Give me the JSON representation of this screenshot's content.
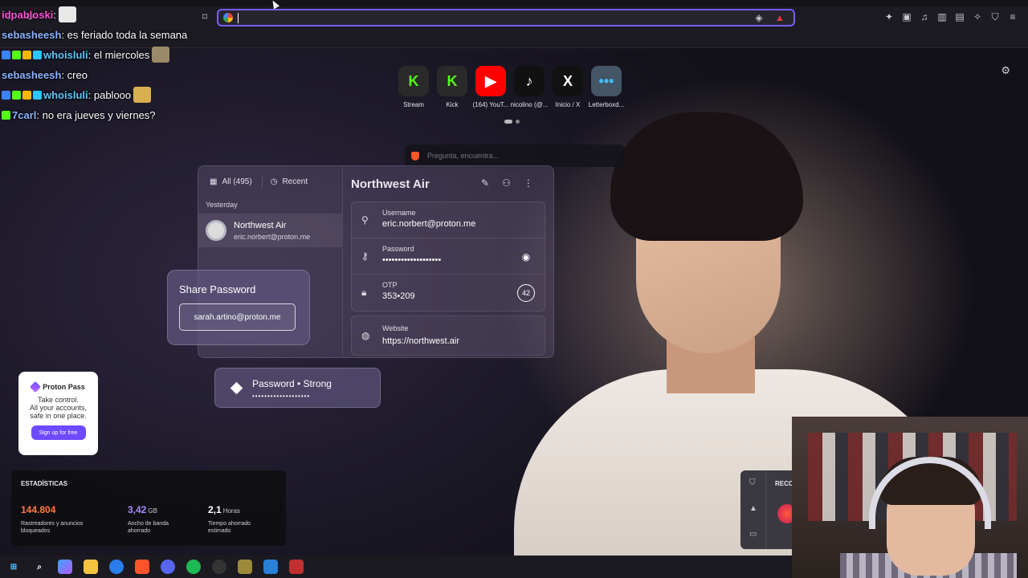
{
  "browser": {
    "url_value": "",
    "url_placeholder": ""
  },
  "chat": [
    {
      "user": "idpabloski",
      "sep": ":",
      "text": "",
      "color": "#ff4fd8"
    },
    {
      "user": "sebasheesh",
      "sep": ":",
      "text": " es feriado toda la semana",
      "color": "#8ab4ff"
    },
    {
      "user": "whoisluli",
      "sep": ":",
      "text": " el miercoles",
      "color": "#5dc8ff"
    },
    {
      "user": "sebasheesh",
      "sep": ":",
      "text": " creo",
      "color": "#8ab4ff"
    },
    {
      "user": "whoisluli",
      "sep": ":",
      "text": " pablooo",
      "color": "#5dc8ff"
    },
    {
      "user": "7carl",
      "sep": ":",
      "text": " no era jueves y viernes?",
      "color": "#8ab4ff"
    }
  ],
  "speed_dial": [
    {
      "label": "Stream",
      "glyph": "K",
      "bg": "#2a2a2a",
      "fg": "#53fc18"
    },
    {
      "label": "Kick",
      "glyph": "K",
      "bg": "#2a2a2a",
      "fg": "#53fc18"
    },
    {
      "label": "(164) YouT...",
      "glyph": "▶",
      "bg": "#ff0000",
      "fg": "#ffffff"
    },
    {
      "label": "nicolino (@...",
      "glyph": "♪",
      "bg": "#111111",
      "fg": "#ffffff"
    },
    {
      "label": "Inicio / X",
      "glyph": "X",
      "bg": "#111111",
      "fg": "#ffffff"
    },
    {
      "label": "Letterboxd...",
      "glyph": "•••",
      "bg": "#445566",
      "fg": "#40bcf4"
    }
  ],
  "search": {
    "placeholder": "Pregunta, encuentra..."
  },
  "pass": {
    "filter_all": "All (495)",
    "filter_recent": "Recent",
    "group": "Yesterday",
    "entry_title": "Northwest Air",
    "entry_email": "eric.norbert@proton.me",
    "item_title": "Northwest Air",
    "username_label": "Username",
    "username_value": "eric.norbert@proton.me",
    "password_label": "Password",
    "password_value": "•••••••••••••••••••",
    "otp_label": "OTP",
    "otp_value": "353•209",
    "otp_timer": "42",
    "website_label": "Website",
    "website_value": "https://northwest.air"
  },
  "share": {
    "title": "Share Password",
    "email": "sarah.artino@proton.me"
  },
  "strong": {
    "title": "Password • Strong",
    "dots": "•••••••••••••••••••"
  },
  "ad": {
    "brand": "Proton Pass",
    "line1": "Take control.",
    "line2": "All your accounts,",
    "line3": "safe in one place.",
    "button": "Sign up for free"
  },
  "stats": {
    "title": "ESTADÍSTICAS",
    "items": [
      {
        "value": "144.804",
        "unit": "",
        "desc1": "Rastreadores y anuncios",
        "desc2": "bloqueados",
        "color": "#ff7a45"
      },
      {
        "value": "3,42",
        "unit": "GB",
        "desc1": "Ancho de banda",
        "desc2": "ahorrado",
        "color": "#a88bff"
      },
      {
        "value": "2,1",
        "unit": "Horas",
        "desc1": "Tiempo ahorrado",
        "desc2": "estimado",
        "color": "#ffffff"
      }
    ]
  },
  "rec_widget": {
    "label": "RECO"
  },
  "colors": {
    "accent": "#7b5cff",
    "brave": "#fb542b"
  }
}
